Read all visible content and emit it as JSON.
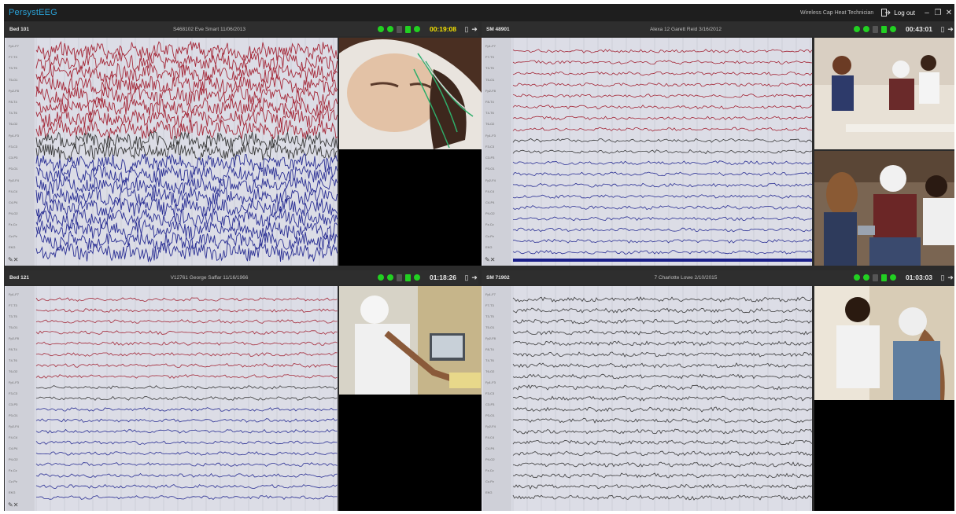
{
  "app": {
    "brand": "PersystEEG",
    "user": "Wireless Cap Heat Technician",
    "logout": "Log out"
  },
  "panels": [
    {
      "bed": "Bed 101",
      "patient": "S468102 Eve Smart 11/06/2013",
      "time": "00:19:08",
      "time_color": "#f4e200"
    },
    {
      "bed": "SM 48901",
      "patient": "Alexa 12 Garett Reid 3/16/2012",
      "time": "00:43:01",
      "time_color": "#e8e8e8"
    },
    {
      "bed": "Bed 121",
      "patient": "V12761 George Saffar 11/16/1966",
      "time": "01:18:26",
      "time_color": "#e8e8e8"
    },
    {
      "bed": "SM 71902",
      "patient": "7 Charlotte Lowe 2/10/2015",
      "time": "01:03:03",
      "time_color": "#e8e8e8"
    }
  ],
  "channels": [
    "Fp1-F7",
    "F7-T3",
    "T3-T5",
    "T5-O1",
    "Fp2-F8",
    "F8-T4",
    "T4-T6",
    "T6-O2",
    "Fp1-F3",
    "F3-C3",
    "C3-P3",
    "P3-O1",
    "Fp2-F4",
    "F4-C4",
    "C4-P4",
    "P4-O2",
    "Fz-Cz",
    "Cz-Pz",
    "EKG"
  ],
  "icons": {
    "status_led": "status-led-icon",
    "logout": "logout-icon",
    "clipboard": "clipboard-icon",
    "forward": "forward-arrow-icon",
    "tools": "tools-icon"
  },
  "colors": {
    "red_trace": "#a52a3a",
    "blue_trace": "#2a2f94",
    "dark_trace": "#3a3a3a",
    "time_highlight": "#f4e200",
    "status_green": "#22d022",
    "brand": "#2aa3d8"
  }
}
